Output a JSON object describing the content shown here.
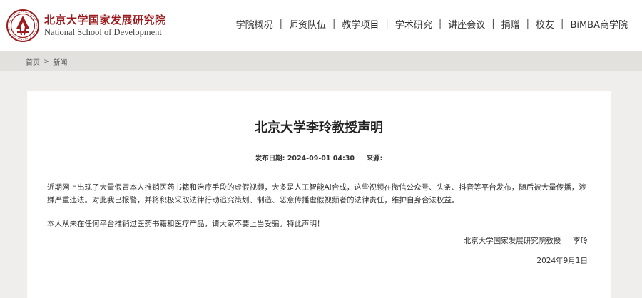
{
  "header": {
    "logo_cn": "北京大学国家发展研究院",
    "logo_en": "National School of Development",
    "nav": [
      "学院概况",
      "师资队伍",
      "教学项目",
      "学术研究",
      "讲座会议",
      "捐赠",
      "校友",
      "BiMBA商学院"
    ]
  },
  "breadcrumb": {
    "home": "首页",
    "separator": ">",
    "current": "新闻"
  },
  "article": {
    "title": "北京大学李玲教授声明",
    "date_label": "发布日期:",
    "date_value": "2024-09-01 04:30",
    "source_label": "来源:",
    "paragraph1": "近期网上出现了大量假冒本人推销医药书籍和治疗手段的虚假视频，大多是人工智能AI合成，这些视频在微信公众号、头条、抖音等平台发布，随后被大量传播，涉嫌严重违法。对此我已报警，并将积极采取法律行动追究策划、制造、恶意传播虚假视频者的法律责任，维护自身合法权益。",
    "paragraph2": "本人从未在任何平台推销过医药书籍和医疗产品，请大家不要上当受骗。特此声明！",
    "signature_org": "北京大学国家发展研究院教授",
    "signature_name": "李玲",
    "sign_date": "2024年9月1日"
  },
  "colors": {
    "brand": "#9b1c1f",
    "page_bg": "#efeeec",
    "breadcrumb_bg": "#e2e1de"
  }
}
